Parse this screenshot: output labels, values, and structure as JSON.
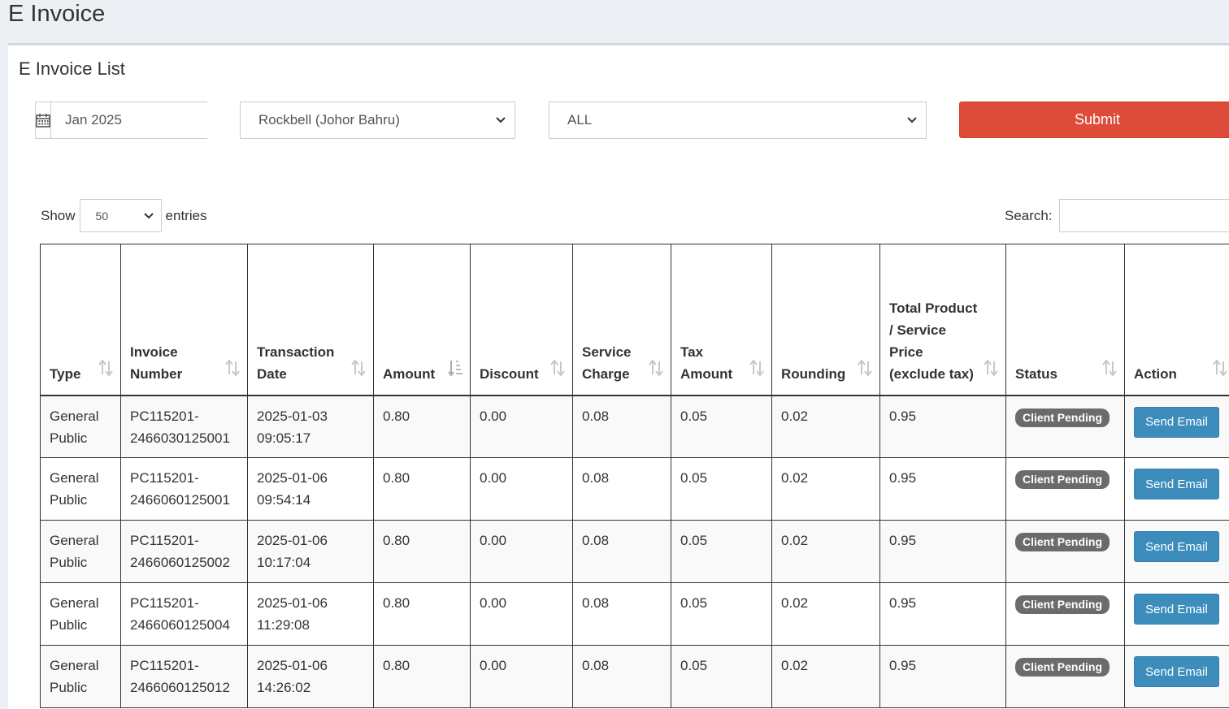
{
  "page": {
    "title": "E Invoice"
  },
  "box": {
    "title": "E Invoice List"
  },
  "filters": {
    "date_value": "Jan 2025",
    "outlet_selected": "Rockbell (Johor Bahru)",
    "status_selected": "ALL",
    "submit_label": "Submit"
  },
  "datatable": {
    "show_label": "Show",
    "length_value": "50",
    "entries_label": "entries",
    "search_label": "Search:",
    "search_value": ""
  },
  "columns": [
    "Type",
    "Invoice Number",
    "Transaction Date",
    "Amount",
    "Discount",
    "Service Charge",
    "Tax Amount",
    "Rounding",
    "Total Product / Service Price (exclude tax)",
    "Status",
    "Action"
  ],
  "rows": [
    {
      "type": "General Public",
      "invoice": "PC115201-2466030125001",
      "date": "2025-01-03",
      "time": "09:05:17",
      "amount": "0.80",
      "discount": "0.00",
      "service": "0.08",
      "tax": "0.05",
      "rounding": "0.02",
      "total": "0.95",
      "status": "Client Pending",
      "action": "Send Email"
    },
    {
      "type": "General Public",
      "invoice": "PC115201-2466060125001",
      "date": "2025-01-06",
      "time": "09:54:14",
      "amount": "0.80",
      "discount": "0.00",
      "service": "0.08",
      "tax": "0.05",
      "rounding": "0.02",
      "total": "0.95",
      "status": "Client Pending",
      "action": "Send Email"
    },
    {
      "type": "General Public",
      "invoice": "PC115201-2466060125002",
      "date": "2025-01-06",
      "time": "10:17:04",
      "amount": "0.80",
      "discount": "0.00",
      "service": "0.08",
      "tax": "0.05",
      "rounding": "0.02",
      "total": "0.95",
      "status": "Client Pending",
      "action": "Send Email"
    },
    {
      "type": "General Public",
      "invoice": "PC115201-2466060125004",
      "date": "2025-01-06",
      "time": "11:29:08",
      "amount": "0.80",
      "discount": "0.00",
      "service": "0.08",
      "tax": "0.05",
      "rounding": "0.02",
      "total": "0.95",
      "status": "Client Pending",
      "action": "Send Email"
    },
    {
      "type": "General Public",
      "invoice": "PC115201-2466060125012",
      "date": "2025-01-06",
      "time": "14:26:02",
      "amount": "0.80",
      "discount": "0.00",
      "service": "0.08",
      "tax": "0.05",
      "rounding": "0.02",
      "total": "0.95",
      "status": "Client Pending",
      "action": "Send Email"
    }
  ],
  "colors": {
    "submit": "#dd4b39",
    "send_email": "#3c8dbc",
    "badge": "#6b6b6b",
    "background": "#ecf0f5"
  },
  "icons": {
    "date_addon": "calendar-icon",
    "select_arrow": "chevron-down-icon",
    "sort_both": "sort-both-icon",
    "sort_active": "sort-ascending-icon"
  }
}
